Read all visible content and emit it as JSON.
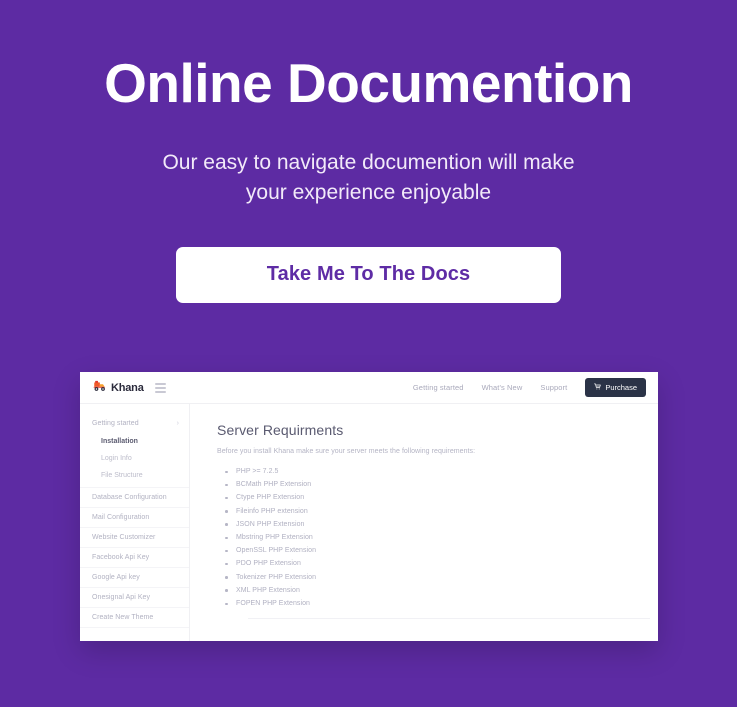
{
  "theme": {
    "background_purple": "#5d2ba3",
    "button_text_purple": "#5e2ca5",
    "purchase_dark": "#2b3347",
    "brand_orange": "#f05a28"
  },
  "hero": {
    "title": "Online Documention",
    "subtitle_line1": "Our easy to navigate documention will make",
    "subtitle_line2": "your experience enjoyable",
    "cta_label": "Take Me To The Docs"
  },
  "mockup": {
    "topbar": {
      "brand_name": "Khana",
      "brand_icon": "scooter-delivery-icon",
      "menu_icon": "hamburger-menu-icon",
      "nav_links": [
        {
          "label": "Getting started"
        },
        {
          "label": "What's New"
        },
        {
          "label": "Support"
        }
      ],
      "purchase": {
        "label": "Purchase",
        "icon": "shopping-cart-icon"
      }
    },
    "sidebar": {
      "items": [
        {
          "label": "Getting started",
          "type": "group",
          "chevron": "›"
        },
        {
          "label": "Installation",
          "type": "sub",
          "active": true
        },
        {
          "label": "Login Info",
          "type": "sub",
          "active": false
        },
        {
          "label": "File Structure",
          "type": "sub",
          "active": false
        },
        {
          "label": "Database Configuration",
          "type": "row"
        },
        {
          "label": "Mail Configuration",
          "type": "row"
        },
        {
          "label": "Website Customizer",
          "type": "row"
        },
        {
          "label": "Facebook Api Key",
          "type": "row"
        },
        {
          "label": "Google Api key",
          "type": "row"
        },
        {
          "label": "Onesignal Api Key",
          "type": "row"
        },
        {
          "label": "Create New Theme",
          "type": "row"
        }
      ]
    },
    "content": {
      "title": "Server Requirments",
      "intro": "Before you install Khana make sure your server meets the following requirements:",
      "requirements": [
        "PHP >= 7.2.5",
        "BCMath PHP Extension",
        "Ctype PHP Extension",
        "Fileinfo PHP extension",
        "JSON PHP Extension",
        "Mbstring PHP Extension",
        "OpenSSL PHP Extension",
        "PDO PHP Extension",
        "Tokenizer PHP Extension",
        "XML PHP Extension",
        "FOPEN PHP Extension"
      ]
    }
  }
}
